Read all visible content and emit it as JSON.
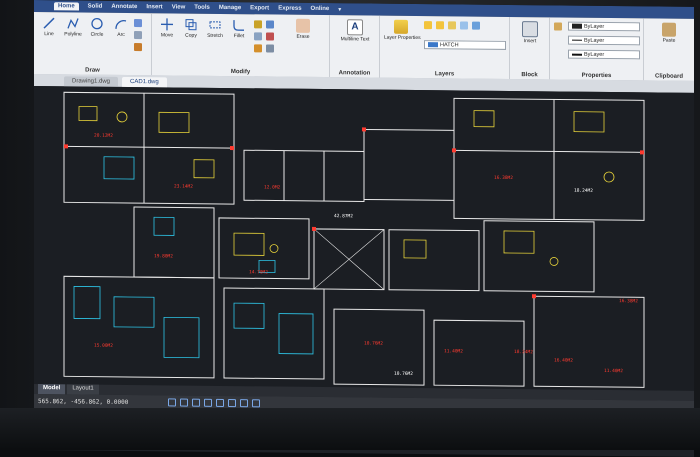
{
  "ribbon_tabs": [
    "Home",
    "Solid",
    "Annotate",
    "Insert",
    "View",
    "Tools",
    "Manage",
    "Export",
    "Express",
    "Online"
  ],
  "active_tab": "Home",
  "panels": {
    "draw": {
      "title": "Draw",
      "tools": [
        "Line",
        "Polyline",
        "Circle",
        "Arc"
      ]
    },
    "modify": {
      "title": "Modify",
      "tools": [
        "Move",
        "Copy",
        "Stretch",
        "Fillet",
        "Erase"
      ]
    },
    "annotation": {
      "title": "Annotation",
      "tools": [
        "Multiline Text"
      ]
    },
    "layers": {
      "title": "Layers",
      "tools": [
        "Layer Properties"
      ],
      "current_layer": "HATCH"
    },
    "block": {
      "title": "Block",
      "tools": [
        "Insert"
      ]
    },
    "properties": {
      "title": "Properties",
      "color": "ByLayer",
      "linetype": "ByLayer",
      "lineweight": "ByLayer"
    },
    "clipboard": {
      "title": "Clipboard",
      "tools": [
        "Paste"
      ]
    }
  },
  "document_tabs": [
    "Drawing1.dwg",
    "CAD1.dwg"
  ],
  "active_document": "CAD1.dwg",
  "layout_tabs": [
    "Model",
    "Layout1"
  ],
  "active_layout": "Model",
  "status": {
    "coordinates": "565.862, -456.862, 0.0000"
  },
  "drawing": {
    "room_labels": [
      "20.12M2",
      "23.14M2",
      "12.0M2",
      "42.87M2",
      "16.38M2",
      "18.24M2",
      "19.80M2",
      "14.70M2",
      "10.76M2",
      "11.40M2",
      "18.24M2",
      "16.40M2",
      "10.76M2",
      "11.40M2",
      "16.38M2",
      "15.00M2"
    ]
  },
  "colors": {
    "ribbon_tab_bg": "#2f4f8a",
    "canvas_bg": "#1b1e23",
    "wall": "#e8e8e8",
    "furniture_yellow": "#e6d23a",
    "furniture_cyan": "#2ec6e8",
    "dimension_red": "#ff3b30"
  }
}
